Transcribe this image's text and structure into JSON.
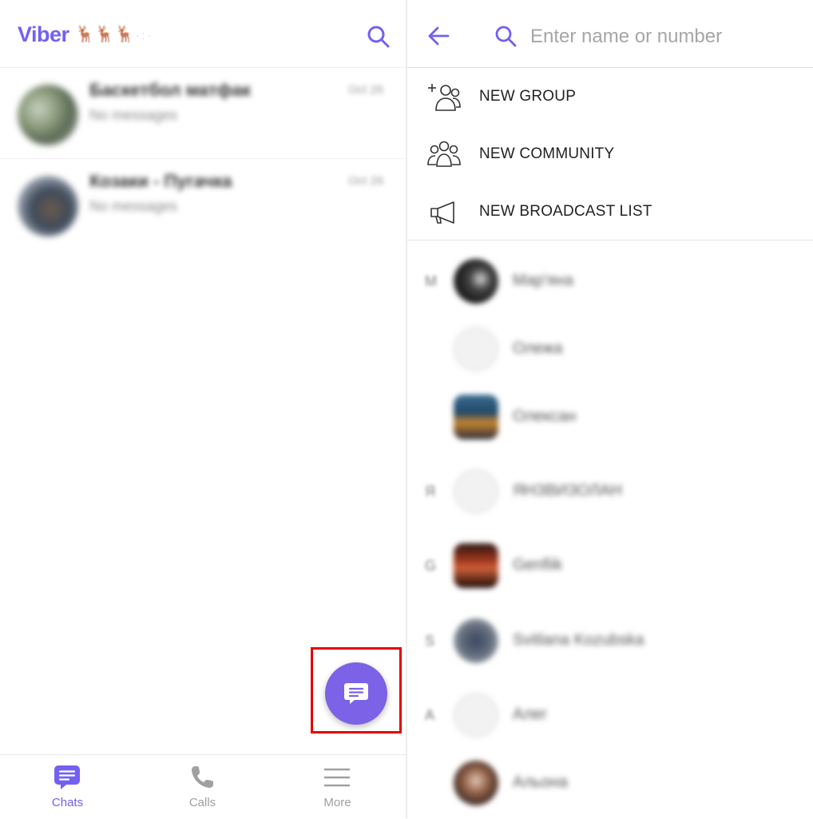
{
  "left": {
    "logo_text": "Viber",
    "chats": [
      {
        "name": "Баскетбол матфак",
        "preview": "No messages",
        "date": "Oct 26"
      },
      {
        "name": "Козаки - Пугачка",
        "preview": "No messages",
        "date": "Oct 26"
      }
    ],
    "nav": {
      "chats": "Chats",
      "calls": "Calls",
      "more": "More"
    }
  },
  "right": {
    "search_placeholder": "Enter name or number",
    "actions": {
      "new_group": "NEW GROUP",
      "new_community": "NEW COMMUNITY",
      "new_broadcast": "NEW BROADCAST LIST"
    },
    "contacts": [
      {
        "letter": "М",
        "name": "Мар'яна"
      },
      {
        "letter": "",
        "name": "Олежа"
      },
      {
        "letter": "",
        "name": "Олексан"
      },
      {
        "letter": "Я",
        "name": "ЯНЗВИЗОЛАН"
      },
      {
        "letter": "G",
        "name": "Genfiik"
      },
      {
        "letter": "S",
        "name": "Svitlana Kozubska"
      },
      {
        "letter": "А",
        "name": "Алег"
      },
      {
        "letter": "",
        "name": "Альона"
      }
    ]
  },
  "colors": {
    "accent": "#7360f2",
    "fab": "#7b62e6",
    "highlight": "#e60000"
  },
  "icons": {
    "left_search": "search-icon",
    "fab": "compose-chat-icon",
    "back": "arrow-left-icon",
    "right_search": "search-icon"
  }
}
